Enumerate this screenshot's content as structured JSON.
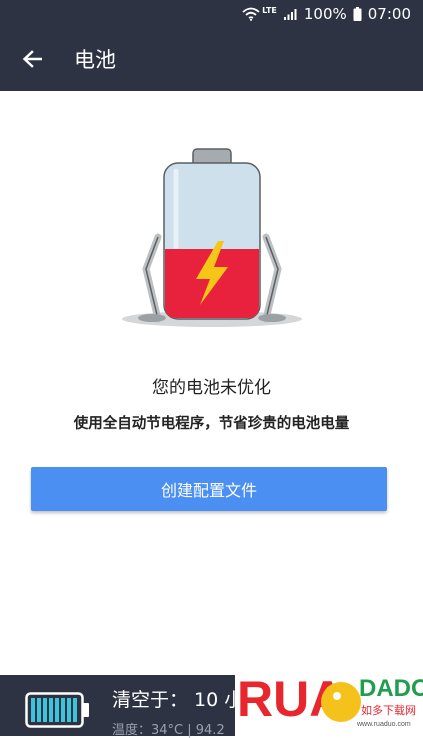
{
  "status_bar": {
    "network": "LTE",
    "battery_percent": "100%",
    "time": "07:00",
    "icons": [
      "wifi-icon",
      "signal-icon",
      "battery-icon"
    ]
  },
  "app_bar": {
    "back_icon": "arrow-left-icon",
    "title": "电池"
  },
  "main": {
    "illustration": "battery-low-charge-icon",
    "headline": "您的电池未优化",
    "subline": "使用全自动节电程序，节省珍贵的电池电量",
    "create_button_label": "创建配置文件"
  },
  "bottom_bar": {
    "battery_icon": "battery-full-icon",
    "clean_label": "清空于： 10 小",
    "temp_label": "温度：34°C | 94.2"
  },
  "watermark": {
    "brand_left": "RUA",
    "brand_right": "DADO",
    "caption": "如多下载网",
    "url": "www.ruaduo.com"
  },
  "colors": {
    "bar_bg": "#2d3342",
    "accent_blue": "#4b8ff2",
    "battery_red": "#e8223d",
    "bolt_yellow": "#f5c518",
    "watermark_red": "#e8262d",
    "watermark_yellow": "#f4c21a",
    "watermark_green": "#1f9e4e"
  }
}
